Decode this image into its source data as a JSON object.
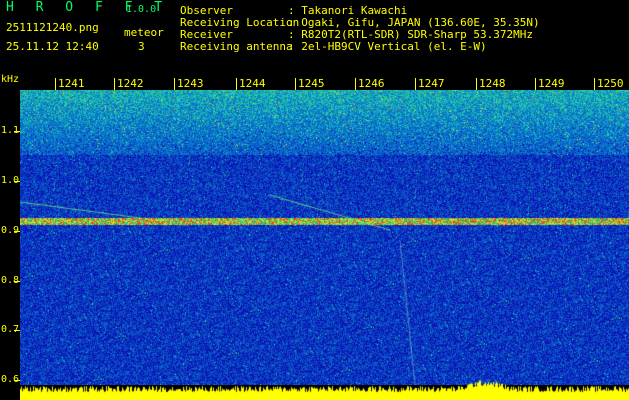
{
  "header": {
    "app_name": "H R O F F T",
    "version": "1.0.0",
    "filename": "2511121240.png",
    "meteor_label": "meteor",
    "datetime": "25.11.12 12:40",
    "meteor_count": "3",
    "info": [
      {
        "label": "Observer",
        "value": ": Takanori Kawachi"
      },
      {
        "label": "Receiving Location",
        "value": ": Ogaki, Gifu, JAPAN (136.60E, 35.35N)"
      },
      {
        "label": "Receiver",
        "value": ": R820T2(RTL-SDR) SDR-Sharp 53.372MHz"
      },
      {
        "label": "Receiving antenna",
        "value": ": 2el-HB9CV Vertical (el. E-W)"
      }
    ]
  },
  "axis": {
    "unit": "kHz",
    "y_labels": [
      "1.1",
      "1.0",
      "0.9",
      "0.8",
      "0.7",
      "0.6"
    ],
    "time_labels": [
      "1241",
      "1242",
      "1243",
      "1244",
      "1245",
      "1246",
      "1247",
      "1248",
      "1249",
      "1250"
    ]
  },
  "colors": {
    "background": "#000000",
    "text": "#ffff00",
    "title": "#00ff66",
    "spectrum_low": "#0a1a8a",
    "spectrum_high": "#ff2a00",
    "bar": "#ffff00"
  }
}
